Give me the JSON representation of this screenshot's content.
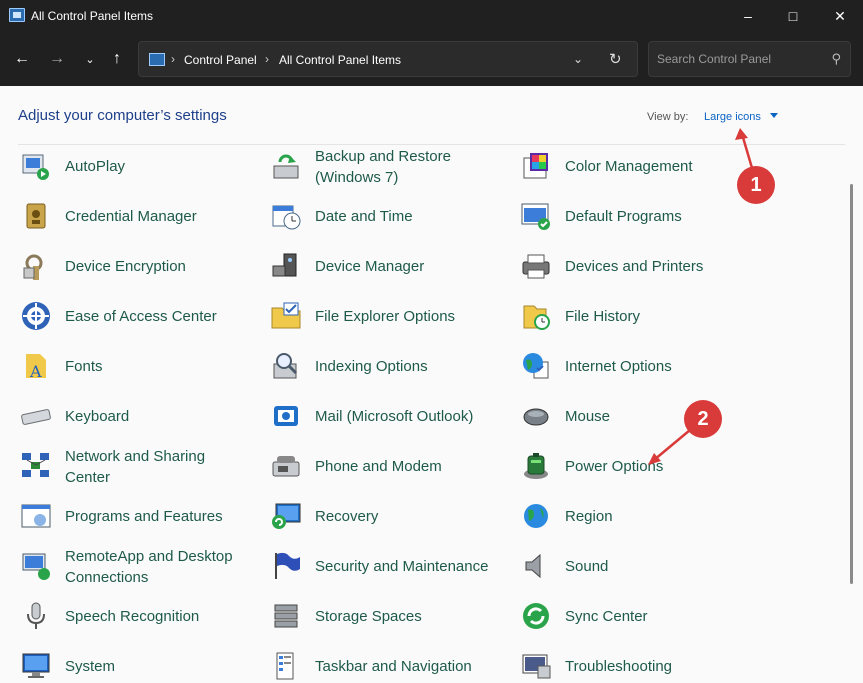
{
  "window": {
    "title": "All Control Panel Items"
  },
  "address": {
    "crumbs": [
      "Control Panel",
      "All Control Panel Items"
    ]
  },
  "search": {
    "placeholder": "Search Control Panel"
  },
  "page": {
    "heading": "Adjust your computer’s settings",
    "view_by_label": "View by:",
    "view_by_value": "Large icons"
  },
  "annotations": [
    "1",
    "2"
  ],
  "colors": {
    "label": "#1e5a4a",
    "heading": "#1e3f8a",
    "link": "#0b63c4",
    "badge": "#d93a3a"
  },
  "items": {
    "col1": [
      {
        "label": "AutoPlay",
        "icon": "autoplay-icon"
      },
      {
        "label": "Credential Manager",
        "icon": "credential-manager-icon"
      },
      {
        "label": "Device Encryption",
        "icon": "device-encryption-icon"
      },
      {
        "label": "Ease of Access Center",
        "icon": "ease-of-access-icon"
      },
      {
        "label": "Fonts",
        "icon": "fonts-icon"
      },
      {
        "label": "Keyboard",
        "icon": "keyboard-icon"
      },
      {
        "label": "Network and Sharing Center",
        "icon": "network-icon"
      },
      {
        "label": "Programs and Features",
        "icon": "programs-icon"
      },
      {
        "label": "RemoteApp and Desktop Connections",
        "icon": "remoteapp-icon"
      },
      {
        "label": "Speech Recognition",
        "icon": "microphone-icon"
      },
      {
        "label": "System",
        "icon": "system-icon"
      }
    ],
    "col2": [
      {
        "label": "Backup and Restore (Windows 7)",
        "icon": "backup-icon"
      },
      {
        "label": "Date and Time",
        "icon": "calendar-clock-icon"
      },
      {
        "label": "Device Manager",
        "icon": "device-manager-icon"
      },
      {
        "label": "File Explorer Options",
        "icon": "folder-options-icon"
      },
      {
        "label": "Indexing Options",
        "icon": "indexing-icon"
      },
      {
        "label": "Mail (Microsoft Outlook)",
        "icon": "mail-icon"
      },
      {
        "label": "Phone and Modem",
        "icon": "phone-icon"
      },
      {
        "label": "Recovery",
        "icon": "recovery-icon"
      },
      {
        "label": "Security and Maintenance",
        "icon": "flag-icon"
      },
      {
        "label": "Storage Spaces",
        "icon": "storage-icon"
      },
      {
        "label": "Taskbar and Navigation",
        "icon": "taskbar-icon"
      }
    ],
    "col3": [
      {
        "label": "Color Management",
        "icon": "color-management-icon"
      },
      {
        "label": "Default Programs",
        "icon": "default-programs-icon"
      },
      {
        "label": "Devices and Printers",
        "icon": "printer-icon"
      },
      {
        "label": "File History",
        "icon": "file-history-icon"
      },
      {
        "label": "Internet Options",
        "icon": "globe-icon"
      },
      {
        "label": "Mouse",
        "icon": "mouse-icon"
      },
      {
        "label": "Power Options",
        "icon": "battery-icon"
      },
      {
        "label": "Region",
        "icon": "region-globe-icon"
      },
      {
        "label": "Sound",
        "icon": "speaker-icon"
      },
      {
        "label": "Sync Center",
        "icon": "sync-icon"
      },
      {
        "label": "Troubleshooting",
        "icon": "troubleshooting-icon"
      }
    ]
  }
}
